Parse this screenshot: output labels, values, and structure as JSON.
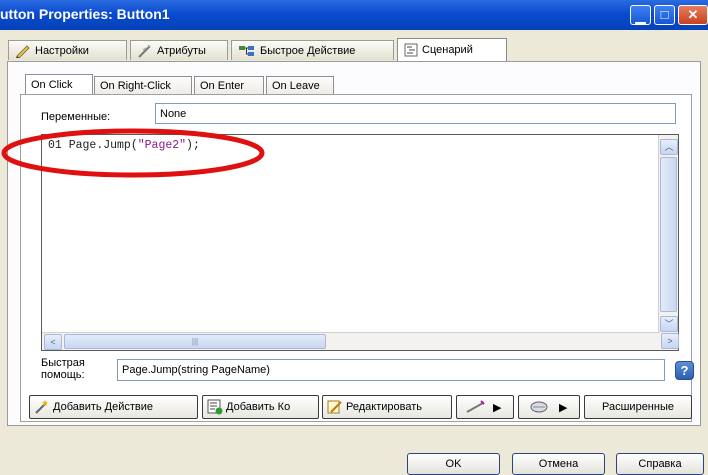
{
  "window": {
    "title": "utton Properties: Button1",
    "controls": [
      "minimize-icon",
      "maximize-icon",
      "close-icon"
    ]
  },
  "tabs": [
    {
      "label": "Настройки",
      "icon": "pencil-icon"
    },
    {
      "label": "Атрибуты",
      "icon": "wand-icon"
    },
    {
      "label": "Быстрое Действие",
      "icon": "flowchart-icon"
    },
    {
      "label": "Сценарий",
      "icon": "script-icon",
      "active": true
    }
  ],
  "event_tabs": [
    {
      "label": "On Click",
      "active": true
    },
    {
      "label": "On Right-Click"
    },
    {
      "label": "On Enter"
    },
    {
      "label": "On Leave"
    }
  ],
  "variables": {
    "label": "Переменные:",
    "value": "None"
  },
  "editor": {
    "line_no": "01",
    "code_prefix": " Page.Jump(",
    "code_string": "\"Page2\"",
    "code_suffix": ");",
    "annotation_color": "#e01010"
  },
  "quick_help": {
    "label_line1": "Быстрая",
    "label_line2": "помощь:",
    "value": "Page.Jump(string PageName)",
    "help_icon": "?"
  },
  "action_buttons": {
    "add_action": "Добавить Действие",
    "add_code": "Добавить Ко",
    "edit": "Редактировать",
    "advanced": "Расширенные"
  },
  "footer": {
    "ok": "OK",
    "cancel": "Отмена",
    "help": "Справка"
  },
  "colors": {
    "titlebar": "#0a4bd0",
    "accent": "#2a6be0"
  }
}
